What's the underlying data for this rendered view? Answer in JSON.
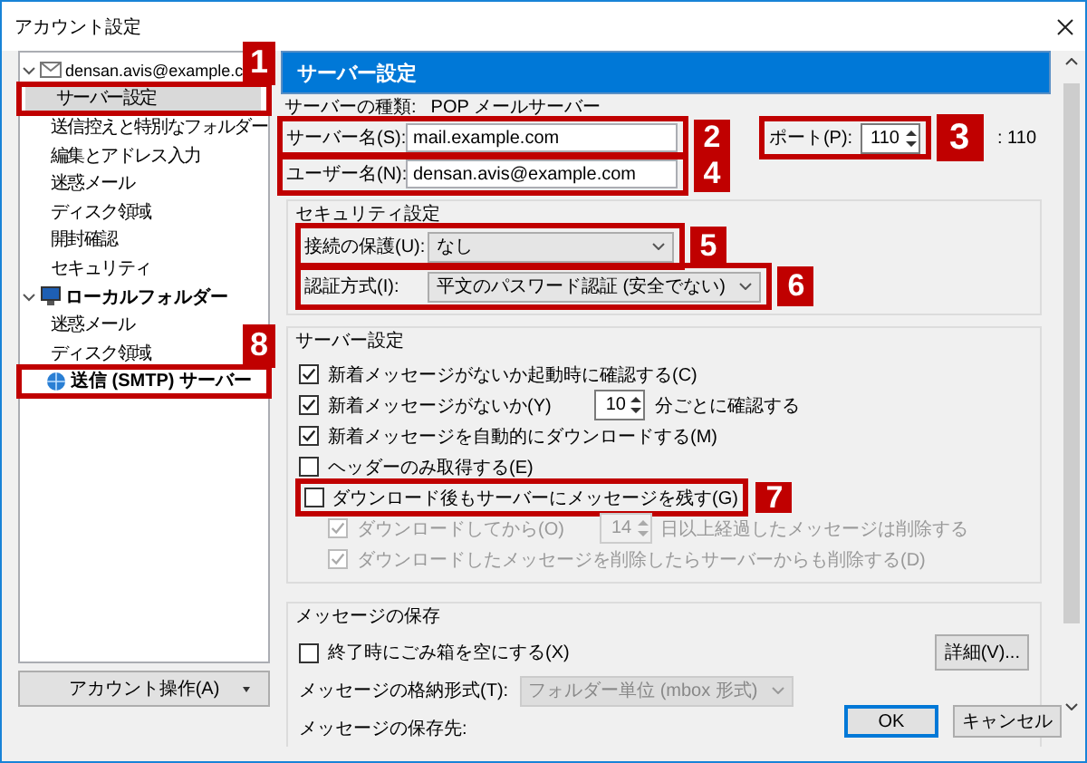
{
  "window": {
    "title": "アカウント設定"
  },
  "sidebar": {
    "items": [
      {
        "label": "densan.avis@example.c",
        "kind": "account",
        "expanded": true,
        "selected": false,
        "children": [
          {
            "label": "サーバー設定",
            "selected": true,
            "annotation": "1"
          },
          {
            "label": "送信控えと特別なフォルダー",
            "selected": false
          },
          {
            "label": "編集とアドレス入力",
            "selected": false
          },
          {
            "label": "迷惑メール",
            "selected": false
          },
          {
            "label": "ディスク領域",
            "selected": false
          },
          {
            "label": "開封確認",
            "selected": false
          },
          {
            "label": "セキュリティ",
            "selected": false
          }
        ]
      },
      {
        "label": "ローカルフォルダー",
        "kind": "local",
        "expanded": true,
        "selected": false,
        "children": [
          {
            "label": "迷惑メール",
            "selected": false
          },
          {
            "label": "ディスク領域",
            "selected": false
          }
        ]
      },
      {
        "label": "送信 (SMTP) サーバー",
        "kind": "smtp",
        "selected": false,
        "annotation": "8"
      }
    ]
  },
  "account_button": {
    "label": "アカウント操作(A)"
  },
  "panel": {
    "title": "サーバー設定",
    "server_type_label": "サーバーの種類:",
    "server_type": "POP メールサーバー",
    "server_name": {
      "label": "サーバー名(S):",
      "value": "mail.example.com",
      "annotation": "2"
    },
    "port": {
      "label": "ポート(P):",
      "value": "110",
      "default": ": 110",
      "annotation": "3"
    },
    "user_name": {
      "label": "ユーザー名(N):",
      "value": "densan.avis@example.com",
      "annotation": "4"
    },
    "security": {
      "title": "セキュリティ設定",
      "fields": [
        {
          "label": "接続の保護(U):",
          "value": "なし",
          "annotation": "5"
        },
        {
          "label": "認証方式(I):",
          "value": "平文のパスワード認証 (安全でない)",
          "annotation": "6"
        }
      ]
    },
    "server_settings": {
      "title": "サーバー設定",
      "options": [
        {
          "label": "新着メッセージがないか起動時に確認する(C)",
          "checked": true,
          "disabled": false
        },
        {
          "label": "新着メッセージがないか(Y)",
          "checked": true,
          "disabled": false,
          "spinner": "10",
          "suffix": "分ごとに確認する"
        },
        {
          "label": "新着メッセージを自動的にダウンロードする(M)",
          "checked": true,
          "disabled": false
        },
        {
          "label": "ヘッダーのみ取得する(E)",
          "checked": false,
          "disabled": false
        },
        {
          "label": "ダウンロード後もサーバーにメッセージを残す(G)",
          "checked": false,
          "disabled": false,
          "annotation": "7",
          "children": [
            {
              "label": "ダウンロードしてから(O)",
              "checked": true,
              "disabled": true,
              "spinner": "14",
              "suffix": "日以上経過したメッセージは削除する"
            },
            {
              "label": "ダウンロードしたメッセージを削除したらサーバーからも削除する(D)",
              "checked": true,
              "disabled": true
            }
          ]
        }
      ]
    },
    "storage": {
      "title": "メッセージの保存",
      "empty_trash": {
        "label": "終了時にごみ箱を空にする(X)",
        "checked": false,
        "disabled": false
      },
      "advanced_button": "詳細(V)...",
      "format_label": "メッセージの格納形式(T):",
      "format_value": "フォルダー単位 (mbox 形式)",
      "format_disabled": true,
      "location_label": "メッセージの保存先:"
    }
  },
  "buttons": [
    {
      "label": "OK",
      "default": true
    },
    {
      "label": "キャンセル",
      "default": false
    }
  ]
}
